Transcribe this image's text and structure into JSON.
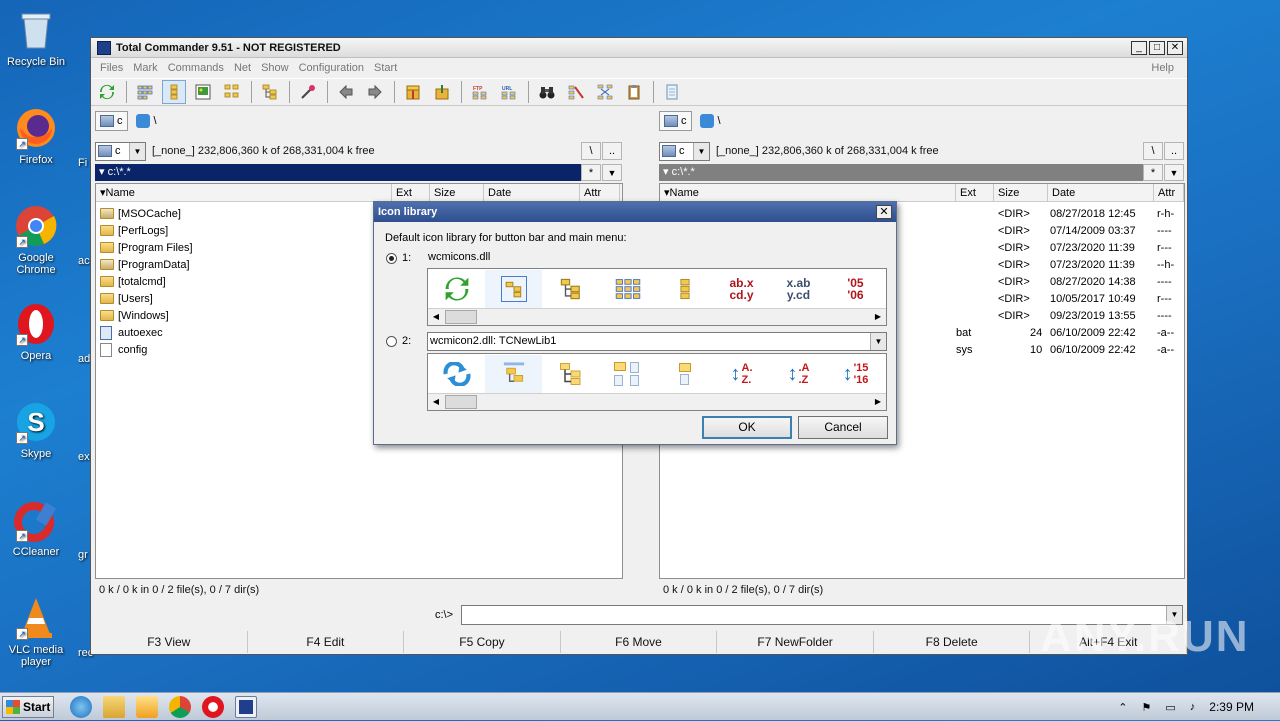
{
  "desktop": {
    "icons": [
      {
        "name": "recycle-bin",
        "label": "Recycle Bin"
      },
      {
        "name": "firefox",
        "label": "Firefox"
      },
      {
        "name": "google-chrome",
        "label": "Google Chrome"
      },
      {
        "name": "opera",
        "label": "Opera"
      },
      {
        "name": "skype",
        "label": "Skype"
      },
      {
        "name": "ccleaner",
        "label": "CCleaner"
      },
      {
        "name": "vlc",
        "label": "VLC media player"
      }
    ],
    "cut_labels": [
      "Fi",
      "ac",
      "ad",
      "ex",
      "gr",
      "rec"
    ]
  },
  "window": {
    "title": "Total Commander 9.51 - NOT REGISTERED",
    "buttons": {
      "minimize": "_",
      "maximize": "□",
      "close": "✕"
    },
    "menu": [
      "Files",
      "Mark",
      "Commands",
      "Net",
      "Show",
      "Configuration",
      "Start"
    ],
    "help": "Help"
  },
  "left": {
    "drive_tab": "c",
    "root": "\\",
    "drive": "c",
    "drive_info": "[_none_]  232,806,360 k of 268,331,004 k free",
    "root_btn": "\\",
    "up_btn": "..",
    "filter": "c:\\*.*",
    "star": "*",
    "down": "▼",
    "columns": {
      "name": "Name",
      "ext": "Ext",
      "size": "Size",
      "date": "Date",
      "attr": "Attr"
    },
    "files": [
      {
        "name": "[MSOCache]",
        "type": "lock"
      },
      {
        "name": "[PerfLogs]",
        "type": "folder"
      },
      {
        "name": "[Program Files]",
        "type": "folder"
      },
      {
        "name": "[ProgramData]",
        "type": "lock"
      },
      {
        "name": "[totalcmd]",
        "type": "folder"
      },
      {
        "name": "[Users]",
        "type": "folder"
      },
      {
        "name": "[Windows]",
        "type": "folder"
      },
      {
        "name": "autoexec",
        "type": "bat"
      },
      {
        "name": "config",
        "type": "file"
      }
    ],
    "status": "0 k / 0 k in 0 / 2 file(s), 0 / 7 dir(s)"
  },
  "right": {
    "drive_tab": "c",
    "root": "\\",
    "drive": "c",
    "drive_info": "[_none_]  232,806,360 k of 268,331,004 k free",
    "root_btn": "\\",
    "up_btn": "..",
    "filter": "c:\\*.*",
    "star": "*",
    "down": "▼",
    "columns": {
      "name": "Name",
      "ext": "Ext",
      "size": "Size",
      "date": "Date",
      "attr": "Attr"
    },
    "rows": [
      {
        "ext": "",
        "size": "<DIR>",
        "date": "08/27/2018 12:45",
        "attr": "r-h-"
      },
      {
        "ext": "",
        "size": "<DIR>",
        "date": "07/14/2009 03:37",
        "attr": "----"
      },
      {
        "ext": "",
        "size": "<DIR>",
        "date": "07/23/2020 11:39",
        "attr": "r---"
      },
      {
        "ext": "",
        "size": "<DIR>",
        "date": "07/23/2020 11:39",
        "attr": "--h-"
      },
      {
        "ext": "",
        "size": "<DIR>",
        "date": "08/27/2020 14:38",
        "attr": "----"
      },
      {
        "ext": "",
        "size": "<DIR>",
        "date": "10/05/2017 10:49",
        "attr": "r---"
      },
      {
        "ext": "",
        "size": "<DIR>",
        "date": "09/23/2019 13:55",
        "attr": "----"
      },
      {
        "ext": "bat",
        "size": "24",
        "date": "06/10/2009 22:42",
        "attr": "-a--"
      },
      {
        "ext": "sys",
        "size": "10",
        "date": "06/10/2009 22:42",
        "attr": "-a--"
      }
    ],
    "status": "0 k / 0 k in 0 / 2 file(s), 0 / 7 dir(s)"
  },
  "cmd": {
    "prompt": "c:\\>",
    "value": ""
  },
  "fkeys": [
    "F3 View",
    "F4 Edit",
    "F5 Copy",
    "F6 Move",
    "F7 NewFolder",
    "F8 Delete",
    "Alt+F4 Exit"
  ],
  "dialog": {
    "title": "Icon library",
    "close": "✕",
    "description": "Default icon library for button bar and main menu:",
    "option1": {
      "label": "1:",
      "value": "wcmicons.dll",
      "selected": true
    },
    "option2": {
      "label": "2:",
      "value": "wcmicon2.dll: TCNewLib1",
      "selected": false
    },
    "lib1_icons": [
      "refresh-icon",
      "brief-view-icon",
      "tree-icon",
      "thumbnails-icon",
      "small-tree-icon",
      "sort-by-ext-icon",
      "sort-by-name-icon",
      "sort-by-date-icon"
    ],
    "lib2_icons": [
      "refresh-icon",
      "tree-icon",
      "tree-branch-icon",
      "thumbnails-icon",
      "page-icon",
      "sort-az-icon",
      "sort-az-ext-icon",
      "sort-date-icon"
    ],
    "text_glyphs": {
      "ext1": "ab.x",
      "ext2": "cd.y",
      "nm1": "x.ab",
      "nm2": "y.cd",
      "yr1": "'05",
      "yr2": "'06",
      "a": "A.",
      "z": "Z.",
      "a2": ".A",
      "z2": ".Z",
      "n1": "'15",
      "n2": "'16"
    },
    "ok": "OK",
    "cancel": "Cancel"
  },
  "taskbar": {
    "start": "Start",
    "time": "2:39 PM"
  },
  "watermark": "ANY.RUN"
}
